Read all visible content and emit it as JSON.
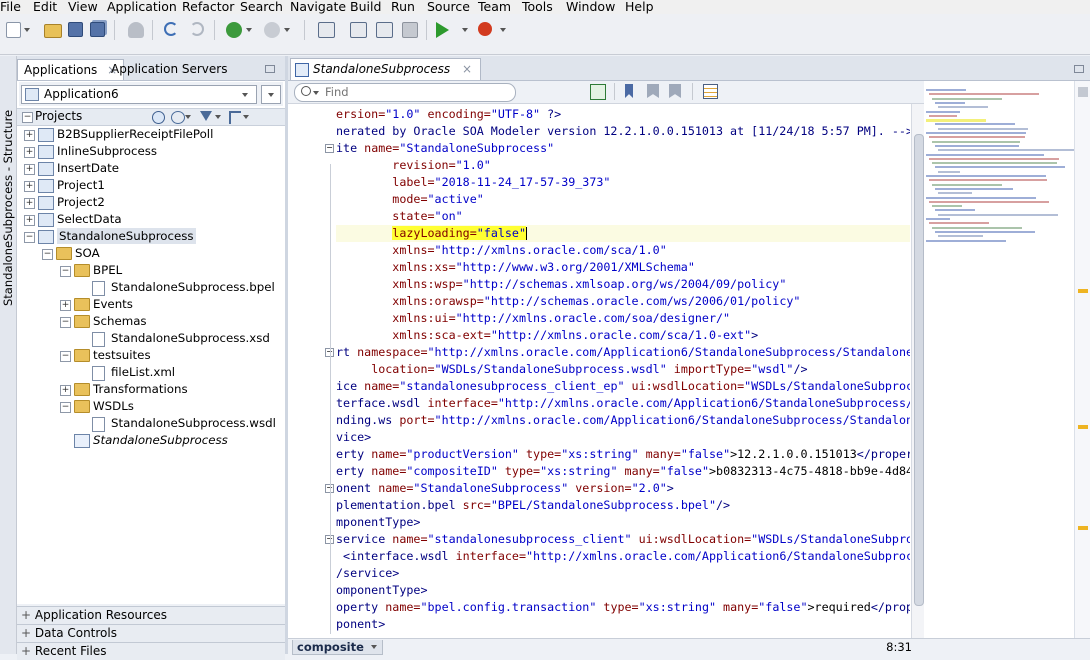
{
  "menu": [
    "File",
    "Edit",
    "View",
    "Application",
    "Refactor",
    "Search",
    "Navigate",
    "Build",
    "Run",
    "Source",
    "Team",
    "Tools",
    "Window",
    "Help"
  ],
  "structure_strip_label": "StandaloneSubprocess - Structure",
  "left_panel": {
    "tabs": [
      {
        "label": "Applications",
        "active": true
      },
      {
        "label": "Application Servers",
        "active": false
      }
    ],
    "application_selector": "Application6",
    "projects_header": "Projects",
    "tree": [
      {
        "label": "B2BSupplierReceiptFilePoll",
        "level": 0,
        "type": "project",
        "expander": "+"
      },
      {
        "label": "InlineSubprocess",
        "level": 0,
        "type": "project",
        "expander": "+"
      },
      {
        "label": "InsertDate",
        "level": 0,
        "type": "project",
        "expander": "+"
      },
      {
        "label": "Project1",
        "level": 0,
        "type": "project",
        "expander": "+"
      },
      {
        "label": "Project2",
        "level": 0,
        "type": "project",
        "expander": "+"
      },
      {
        "label": "SelectData",
        "level": 0,
        "type": "project",
        "expander": "+"
      },
      {
        "label": "StandaloneSubprocess",
        "level": 0,
        "type": "project",
        "expander": "-",
        "selected": true
      },
      {
        "label": "SOA",
        "level": 1,
        "type": "folder",
        "expander": "-"
      },
      {
        "label": "BPEL",
        "level": 2,
        "type": "folder",
        "expander": "-"
      },
      {
        "label": "StandaloneSubprocess.bpel",
        "level": 3,
        "type": "file"
      },
      {
        "label": "Events",
        "level": 2,
        "type": "folder",
        "expander": "+"
      },
      {
        "label": "Schemas",
        "level": 2,
        "type": "folder",
        "expander": "-"
      },
      {
        "label": "StandaloneSubprocess.xsd",
        "level": 3,
        "type": "file"
      },
      {
        "label": "testsuites",
        "level": 2,
        "type": "folder",
        "expander": "-"
      },
      {
        "label": "fileList.xml",
        "level": 3,
        "type": "file"
      },
      {
        "label": "Transformations",
        "level": 2,
        "type": "folder",
        "expander": "+"
      },
      {
        "label": "WSDLs",
        "level": 2,
        "type": "folder",
        "expander": "-"
      },
      {
        "label": "StandaloneSubprocess.wsdl",
        "level": 3,
        "type": "file"
      },
      {
        "label": "StandaloneSubprocess",
        "level": 2,
        "type": "composite",
        "italic": true
      }
    ],
    "bottom_sections": [
      "Application Resources",
      "Data Controls",
      "Recent Files"
    ]
  },
  "editor": {
    "tab_label": "StandaloneSubprocess",
    "find_placeholder": "Find",
    "bottom_tab": "composite",
    "caret_position": "8:31",
    "code_lines": [
      {
        "t": [
          [
            "attr",
            "ersion="
          ],
          [
            "val",
            "\"1.0\""
          ],
          [
            "attr",
            " encoding="
          ],
          [
            "val",
            "\"UTF-8\""
          ],
          [
            "tag",
            " ?>"
          ]
        ],
        "indent": 0
      },
      {
        "t": [
          [
            "tag",
            "nerated by Oracle SOA Modeler version 12.2.1.0.0.151013 at [11/24/18 5:57 PM]. -->"
          ]
        ],
        "indent": 0
      },
      {
        "t": [
          [
            "tag",
            "ite "
          ],
          [
            "attr",
            "name="
          ],
          [
            "val",
            "\"StandaloneSubprocess\""
          ]
        ],
        "indent": 0,
        "fold": "-"
      },
      {
        "t": [
          [
            "attr",
            "revision="
          ],
          [
            "val",
            "\"1.0\""
          ]
        ],
        "indent": 3
      },
      {
        "t": [
          [
            "attr",
            "label="
          ],
          [
            "val",
            "\"2018-11-24_17-57-39_373\""
          ]
        ],
        "indent": 3
      },
      {
        "t": [
          [
            "attr",
            "mode="
          ],
          [
            "val",
            "\"active\""
          ]
        ],
        "indent": 3
      },
      {
        "t": [
          [
            "attr",
            "state="
          ],
          [
            "val",
            "\"on\""
          ]
        ],
        "indent": 3
      },
      {
        "t": [
          [
            "attr",
            "lazyLoading="
          ],
          [
            "val",
            "\"false\""
          ]
        ],
        "indent": 3,
        "current": true
      },
      {
        "t": [
          [
            "attr",
            "xmlns="
          ],
          [
            "val",
            "\"http://xmlns.oracle.com/sca/1.0\""
          ]
        ],
        "indent": 3
      },
      {
        "t": [
          [
            "attr",
            "xmlns:xs="
          ],
          [
            "val",
            "\"http://www.w3.org/2001/XMLSchema\""
          ]
        ],
        "indent": 3
      },
      {
        "t": [
          [
            "attr",
            "xmlns:wsp="
          ],
          [
            "val",
            "\"http://schemas.xmlsoap.org/ws/2004/09/policy\""
          ]
        ],
        "indent": 3
      },
      {
        "t": [
          [
            "attr",
            "xmlns:orawsp="
          ],
          [
            "val",
            "\"http://schemas.oracle.com/ws/2006/01/policy\""
          ]
        ],
        "indent": 3
      },
      {
        "t": [
          [
            "attr",
            "xmlns:ui="
          ],
          [
            "val",
            "\"http://xmlns.oracle.com/soa/designer/\""
          ]
        ],
        "indent": 3
      },
      {
        "t": [
          [
            "attr",
            "xmlns:sca-ext="
          ],
          [
            "val",
            "\"http://xmlns.oracle.com/sca/1.0-ext\""
          ],
          [
            "tag",
            ">"
          ]
        ],
        "indent": 3
      },
      {
        "t": [
          [
            "tag",
            "rt "
          ],
          [
            "attr",
            "namespace="
          ],
          [
            "val",
            "\"http://xmlns.oracle.com/Application6/StandaloneSubprocess/Standalone"
          ]
        ],
        "indent": 0,
        "fold": "-"
      },
      {
        "t": [
          [
            "attr",
            "location="
          ],
          [
            "val",
            "\"WSDLs/StandaloneSubprocess.wsdl\""
          ],
          [
            "attr",
            " importType="
          ],
          [
            "val",
            "\"wsdl\""
          ],
          [
            "tag",
            "/>"
          ]
        ],
        "indent": 2
      },
      {
        "t": [
          [
            "tag",
            "ice "
          ],
          [
            "attr",
            "name="
          ],
          [
            "val",
            "\"standalonesubprocess_client_ep\""
          ],
          [
            "attr",
            " ui:wsdlLocation="
          ],
          [
            "val",
            "\"WSDLs/StandaloneSubproc"
          ]
        ],
        "indent": 0
      },
      {
        "t": [
          [
            "tag",
            "terface.wsdl "
          ],
          [
            "attr",
            "interface="
          ],
          [
            "val",
            "\"http://xmlns.oracle.com/Application6/StandaloneSubprocess/"
          ]
        ],
        "indent": 0
      },
      {
        "t": [
          [
            "tag",
            "nding.ws "
          ],
          [
            "attr",
            "port="
          ],
          [
            "val",
            "\"http://xmlns.oracle.com/Application6/StandaloneSubprocess/Standalon"
          ]
        ],
        "indent": 0
      },
      {
        "t": [
          [
            "tag",
            "vice>"
          ]
        ],
        "indent": 0
      },
      {
        "t": [
          [
            "tag",
            "erty "
          ],
          [
            "attr",
            "name="
          ],
          [
            "val",
            "\"productVersion\""
          ],
          [
            "attr",
            " type="
          ],
          [
            "val",
            "\"xs:string\""
          ],
          [
            "attr",
            " many="
          ],
          [
            "val",
            "\"false\""
          ],
          [
            "plain",
            ">12.2.1.0.0.151013"
          ],
          [
            "tag",
            "</proper"
          ]
        ],
        "indent": 0
      },
      {
        "t": [
          [
            "tag",
            "erty "
          ],
          [
            "attr",
            "name="
          ],
          [
            "val",
            "\"compositeID\""
          ],
          [
            "attr",
            " type="
          ],
          [
            "val",
            "\"xs:string\""
          ],
          [
            "attr",
            " many="
          ],
          [
            "val",
            "\"false\""
          ],
          [
            "plain",
            ">b0832313-4c75-4818-bb9e-4d84"
          ]
        ],
        "indent": 0
      },
      {
        "t": [
          [
            "tag",
            "onent "
          ],
          [
            "attr",
            "name="
          ],
          [
            "val",
            "\"StandaloneSubprocess\""
          ],
          [
            "attr",
            " version="
          ],
          [
            "val",
            "\"2.0\""
          ],
          [
            "tag",
            ">"
          ]
        ],
        "indent": 0,
        "fold": "-"
      },
      {
        "t": [
          [
            "tag",
            "plementation.bpel "
          ],
          [
            "attr",
            "src="
          ],
          [
            "val",
            "\"BPEL/StandaloneSubprocess.bpel\""
          ],
          [
            "tag",
            "/>"
          ]
        ],
        "indent": 0
      },
      {
        "t": [
          [
            "tag",
            "mponentType>"
          ]
        ],
        "indent": 0
      },
      {
        "t": [
          [
            "tag",
            "service "
          ],
          [
            "attr",
            "name="
          ],
          [
            "val",
            "\"standalonesubprocess_client\""
          ],
          [
            "attr",
            " ui:wsdlLocation="
          ],
          [
            "val",
            "\"WSDLs/StandaloneSubpro"
          ]
        ],
        "indent": 0,
        "fold": "-"
      },
      {
        "t": [
          [
            "tag",
            " <interface.wsdl "
          ],
          [
            "attr",
            "interface="
          ],
          [
            "val",
            "\"http://xmlns.oracle.com/Application6/StandaloneSubprocess/"
          ]
        ],
        "indent": 0
      },
      {
        "t": [
          [
            "tag",
            "/service>"
          ]
        ],
        "indent": 0
      },
      {
        "t": [
          [
            "tag",
            "omponentType>"
          ]
        ],
        "indent": 0
      },
      {
        "t": [
          [
            "tag",
            "operty "
          ],
          [
            "attr",
            "name="
          ],
          [
            "val",
            "\"bpel.config.transaction\""
          ],
          [
            "attr",
            " type="
          ],
          [
            "val",
            "\"xs:string\""
          ],
          [
            "attr",
            " many="
          ],
          [
            "val",
            "\"false\""
          ],
          [
            "plain",
            ">required"
          ],
          [
            "tag",
            "</prop"
          ]
        ],
        "indent": 0
      },
      {
        "t": [
          [
            "tag",
            "ponent>"
          ]
        ],
        "indent": 0
      }
    ]
  }
}
